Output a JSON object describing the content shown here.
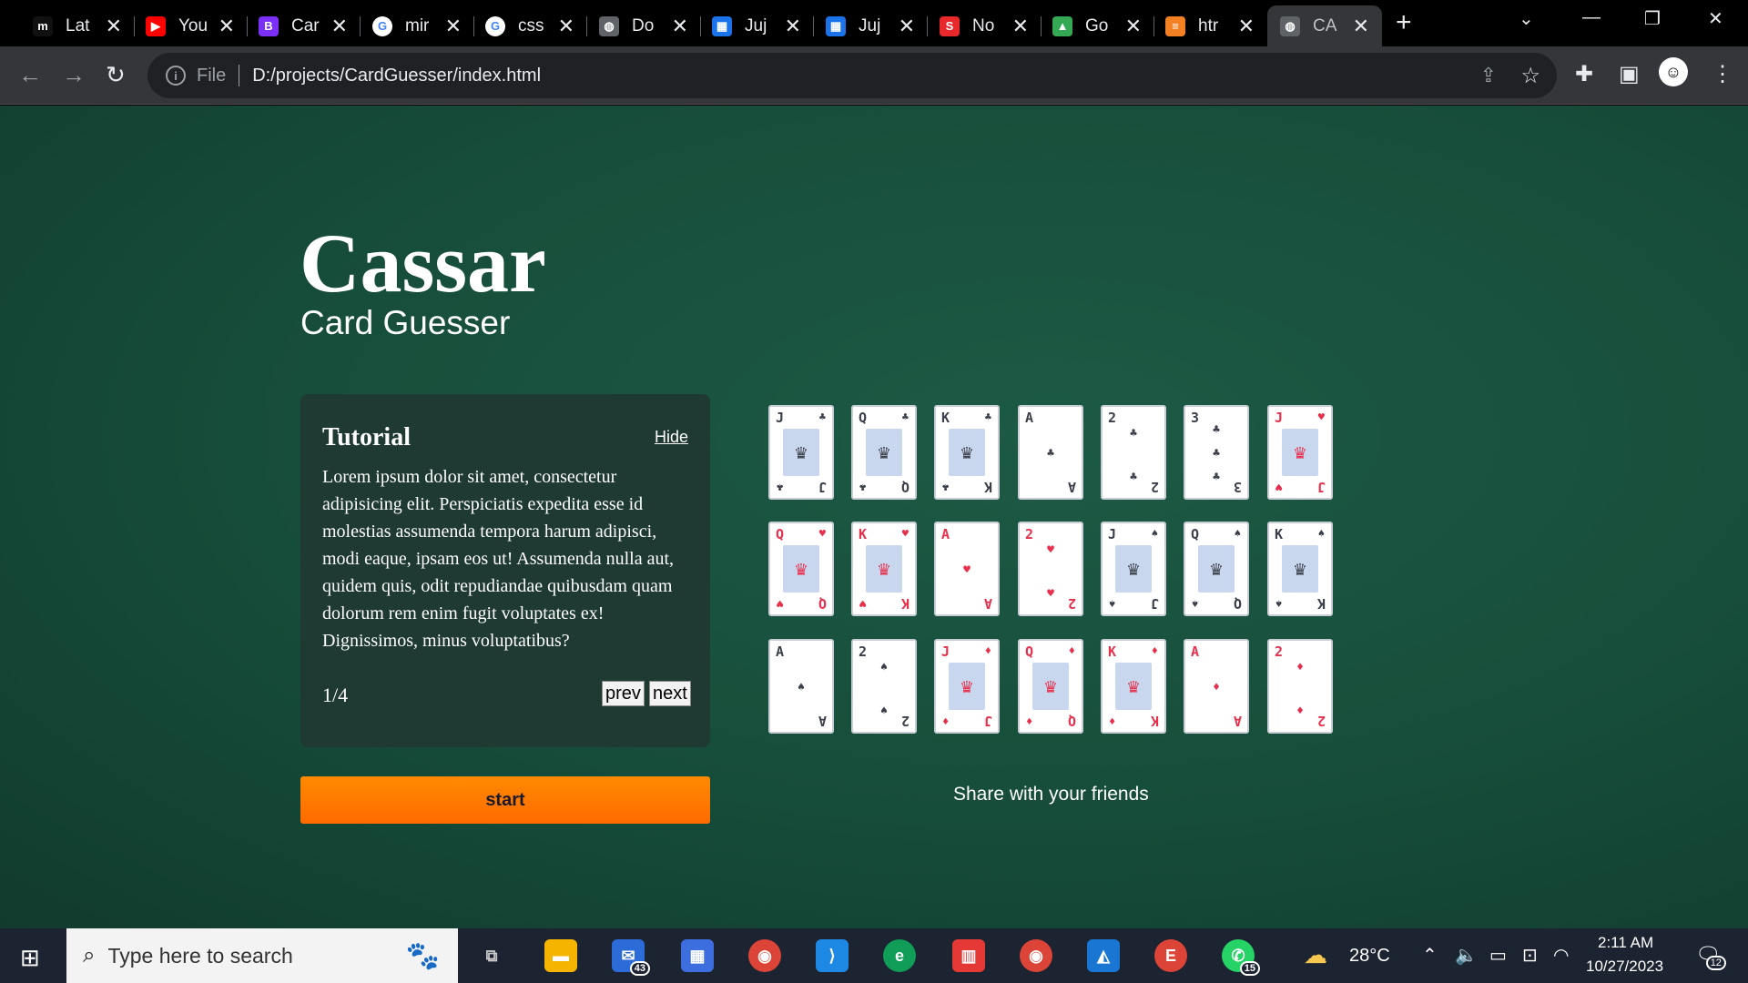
{
  "tabs": [
    {
      "label": "Lat",
      "favicon_color": "#111111",
      "favicon": "m"
    },
    {
      "label": "You",
      "favicon_color": "#ff0000",
      "favicon": "▶"
    },
    {
      "label": "Car",
      "favicon_color": "#7b2ff7",
      "favicon": "B"
    },
    {
      "label": "mir",
      "favicon_color": "#ffffff",
      "favicon": "G"
    },
    {
      "label": "css",
      "favicon_color": "#ffffff",
      "favicon": "G"
    },
    {
      "label": "Do",
      "favicon_color": "#5f6368",
      "favicon": "◍"
    },
    {
      "label": "Juj",
      "favicon_color": "#1a73e8",
      "favicon": "▦"
    },
    {
      "label": "Juj",
      "favicon_color": "#1a73e8",
      "favicon": "▦"
    },
    {
      "label": "No",
      "favicon_color": "#e8282b",
      "favicon": "S"
    },
    {
      "label": "Go",
      "favicon_color": "#34a853",
      "favicon": "▲"
    },
    {
      "label": "htr",
      "favicon_color": "#f48024",
      "favicon": "≡"
    },
    {
      "label": "CA",
      "favicon_color": "#5f6368",
      "favicon": "◍",
      "active": true
    }
  ],
  "address": {
    "scheme": "File",
    "url": "D:/projects/CardGuesser/index.html"
  },
  "page": {
    "title": "Cassar",
    "subtitle": "Card Guesser",
    "tutorial": {
      "heading": "Tutorial",
      "hide_label": "Hide",
      "body": "Lorem ipsum dolor sit amet, consectetur adipisicing elit. Perspiciatis expedita esse id molestias assumenda tempora harum adipisci, modi eaque, ipsam eos ut! Assumenda nulla aut, quidem quis, odit repudiandae quibusdam quam dolorum rem enim fugit voluptates ex! Dignissimos, minus voluptatibus?",
      "page_indicator": "1/4",
      "prev_label": "prev",
      "next_label": "next"
    },
    "start_label": "start",
    "share_text": "Share with your friends"
  },
  "cards": [
    [
      {
        "rank": "J",
        "suit": "♣",
        "color": "black"
      },
      {
        "rank": "Q",
        "suit": "♣",
        "color": "black"
      },
      {
        "rank": "K",
        "suit": "♣",
        "color": "black"
      },
      {
        "rank": "A",
        "suit": "♣",
        "color": "black"
      },
      {
        "rank": "2",
        "suit": "♣",
        "color": "black"
      },
      {
        "rank": "3",
        "suit": "♣",
        "color": "black"
      },
      {
        "rank": "J",
        "suit": "♥",
        "color": "red"
      }
    ],
    [
      {
        "rank": "Q",
        "suit": "♥",
        "color": "red"
      },
      {
        "rank": "K",
        "suit": "♥",
        "color": "red"
      },
      {
        "rank": "A",
        "suit": "♥",
        "color": "red"
      },
      {
        "rank": "2",
        "suit": "♥",
        "color": "red"
      },
      {
        "rank": "J",
        "suit": "♠",
        "color": "black"
      },
      {
        "rank": "Q",
        "suit": "♠",
        "color": "black"
      },
      {
        "rank": "K",
        "suit": "♠",
        "color": "black"
      }
    ],
    [
      {
        "rank": "A",
        "suit": "♠",
        "color": "black"
      },
      {
        "rank": "2",
        "suit": "♠",
        "color": "black"
      },
      {
        "rank": "J",
        "suit": "♦",
        "color": "red"
      },
      {
        "rank": "Q",
        "suit": "♦",
        "color": "red"
      },
      {
        "rank": "K",
        "suit": "♦",
        "color": "red"
      },
      {
        "rank": "A",
        "suit": "♦",
        "color": "red"
      },
      {
        "rank": "2",
        "suit": "♦",
        "color": "red"
      }
    ]
  ],
  "taskbar": {
    "search_placeholder": "Type here to search",
    "mail_badge": "43",
    "whatsapp_badge": "15",
    "weather": "28°C",
    "time": "2:11 AM",
    "date": "10/27/2023",
    "notifications": "12"
  }
}
